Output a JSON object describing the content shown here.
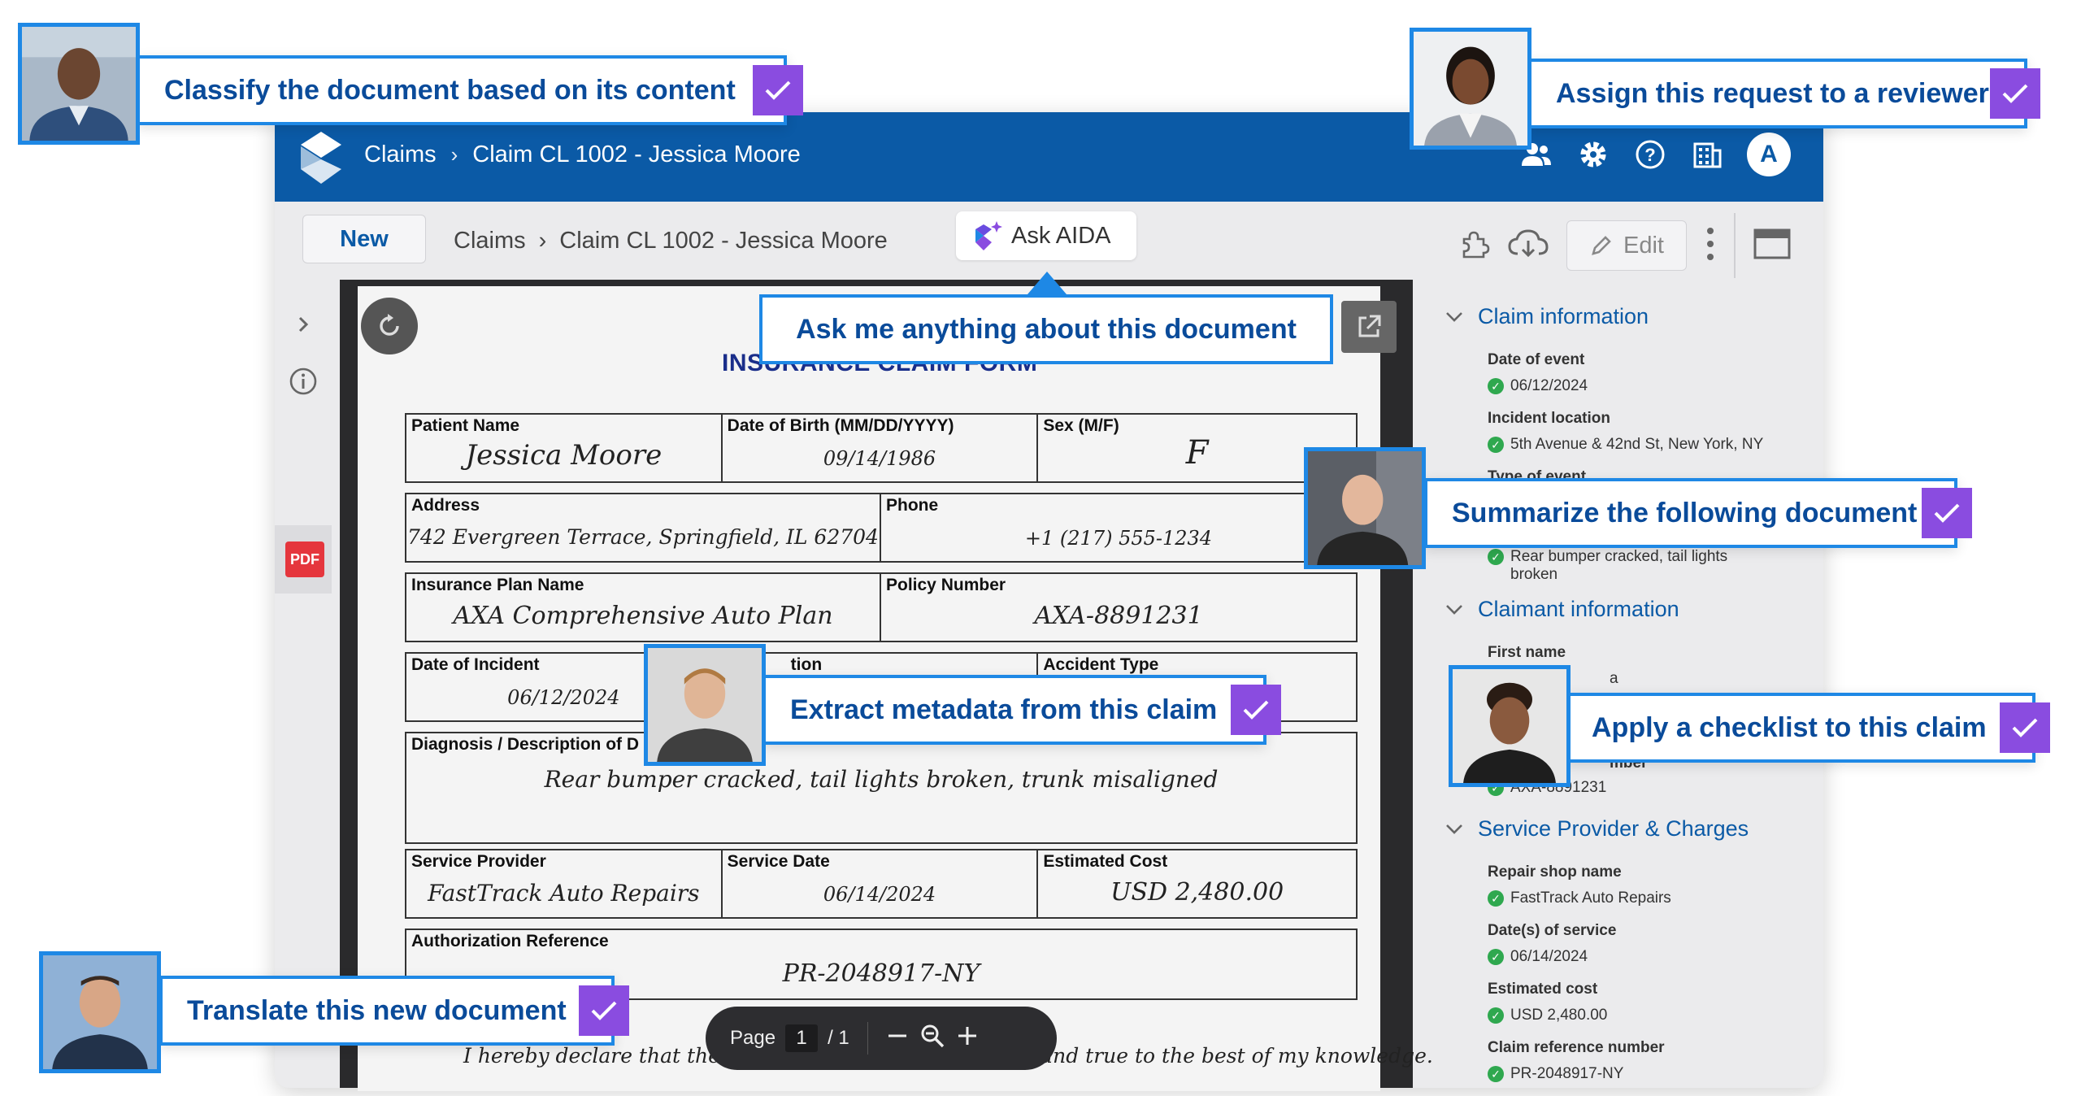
{
  "topbar": {
    "crumb_root": "Claims",
    "crumb_current": "Claim CL 1002 - Jessica Moore",
    "avatar_initial": "A"
  },
  "toolbar": {
    "new_label": "New",
    "crumb_root": "Claims",
    "crumb_current": "Claim CL 1002 - Jessica Moore",
    "ask_label": "Ask AIDA",
    "edit_label": "Edit"
  },
  "rail": {
    "pdf_label": "PDF"
  },
  "document": {
    "title": "INSURANCE CLAIM FORM",
    "fields": {
      "patient_name_label": "Patient Name",
      "patient_name": "Jessica Moore",
      "dob_label": "Date of Birth (MM/DD/YYYY)",
      "dob": "09/14/1986",
      "sex_label": "Sex (M/F)",
      "sex": "F",
      "address_label": "Address",
      "address": "742 Evergreen Terrace, Springfield, IL 62704",
      "phone_label": "Phone",
      "phone": "+1 (217) 555-1234",
      "plan_label": "Insurance Plan Name",
      "plan": "AXA Comprehensive Auto Plan",
      "policy_label": "Policy Number",
      "policy": "AXA-8891231",
      "incident_date_label": "Date of Incident",
      "incident_date": "06/12/2024",
      "location_label_tail": "tion",
      "accident_type_label": "Accident Type",
      "diagnosis_label": "Diagnosis / Description of D",
      "diagnosis": "Rear bumper cracked, tail lights broken, trunk misaligned",
      "provider_label": "Service Provider",
      "provider": "FastTrack Auto Repairs",
      "service_date_label": "Service Date",
      "service_date": "06/14/2024",
      "cost_label": "Estimated Cost",
      "cost": "USD 2,480.00",
      "auth_label": "Authorization Reference",
      "auth": "PR-2048917-NY",
      "declaration": "I hereby declare that the above information is accurate and true to the best of my knowledge."
    }
  },
  "pager": {
    "label": "Page",
    "current": "1",
    "total": "/ 1"
  },
  "panel": {
    "claim_section": "Claim information",
    "date_of_event_label": "Date of event",
    "date_of_event": "06/12/2024",
    "incident_location_label": "Incident location",
    "incident_location": "5th Avenue & 42nd St, New York, NY",
    "type_of_event_label": "Type of event",
    "damage_value": "Rear bumper cracked, tail lights broken",
    "claimant_section": "Claimant information",
    "first_name_label": "First name",
    "first_name_tail": "a",
    "policy_label_tail": "mber",
    "policy_value": "AXA-8891231",
    "service_section": "Service Provider & Charges",
    "repair_shop_label": "Repair shop name",
    "repair_shop": "FastTrack Auto Repairs",
    "service_dates_label": "Date(s) of service",
    "service_dates": "06/14/2024",
    "estimated_cost_label": "Estimated cost",
    "estimated_cost": "USD 2,480.00",
    "claim_ref_label": "Claim reference number",
    "claim_ref": "PR-2048917-NY"
  },
  "callouts": {
    "classify": "Classify the document based on its content",
    "assign": "Assign this request to a reviewer",
    "ask": "Ask me anything about this document",
    "summarize": "Summarize the following document",
    "extract": "Extract metadata from this claim",
    "checklist": "Apply a checklist to this claim",
    "translate": "Translate this new document"
  },
  "colors": {
    "brand_blue": "#0b5aa6",
    "callout_border": "#1e88e5",
    "check_purple": "#8a4ce0",
    "status_green": "#2fa84f",
    "pdf_red": "#e5363d"
  }
}
